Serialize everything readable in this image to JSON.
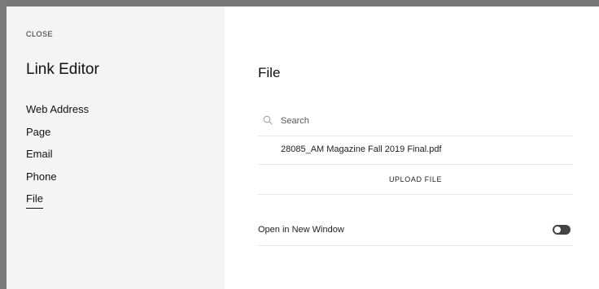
{
  "sidebar": {
    "close_label": "CLOSE",
    "title": "Link Editor",
    "items": [
      {
        "label": "Web Address"
      },
      {
        "label": "Page"
      },
      {
        "label": "Email"
      },
      {
        "label": "Phone"
      },
      {
        "label": "File",
        "active": true
      }
    ]
  },
  "main": {
    "title": "File",
    "search": {
      "placeholder": "Search",
      "value": "",
      "icon": "search-icon"
    },
    "files": [
      {
        "name": "28085_AM Magazine Fall 2019 Final.pdf"
      }
    ],
    "upload_label": "UPLOAD FILE",
    "open_new_window": {
      "label": "Open in New Window",
      "enabled": false
    }
  },
  "colors": {
    "sidebar_bg": "#f4f4f4",
    "frame": "#777777",
    "toggle": "#444444",
    "divider": "#e6e6e6"
  }
}
